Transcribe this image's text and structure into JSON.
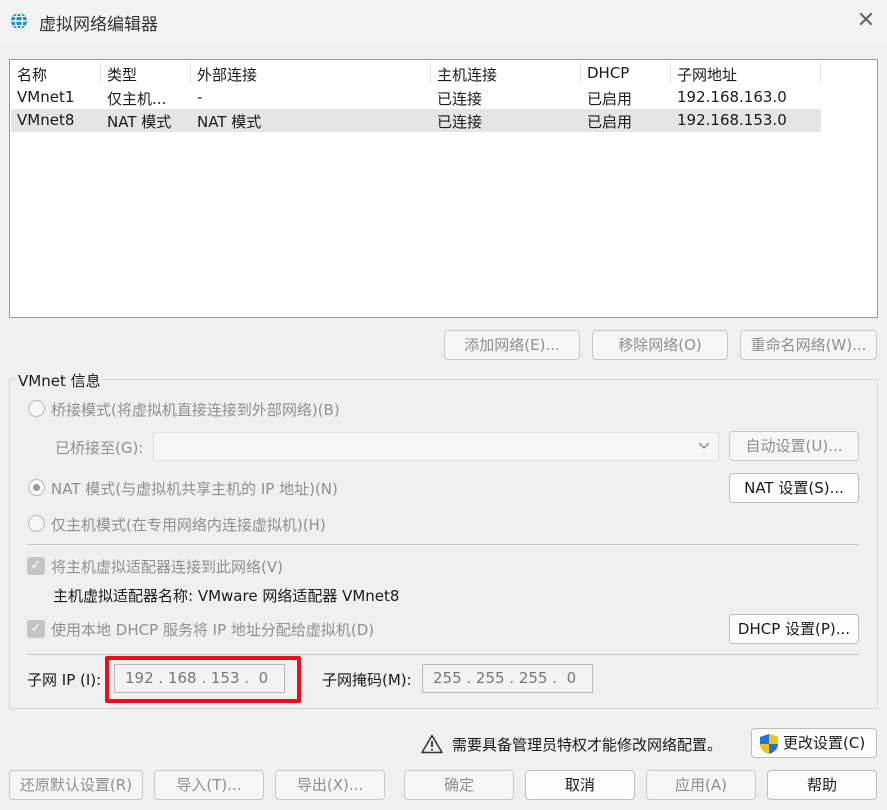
{
  "window": {
    "title": "虚拟网络编辑器",
    "icon": "globe-icon",
    "close_icon": "close-icon"
  },
  "network_table": {
    "columns": [
      "名称",
      "类型",
      "外部连接",
      "主机连接",
      "DHCP",
      "子网地址"
    ],
    "rows": [
      {
        "name": "VMnet1",
        "type": "仅主机...",
        "external": "-",
        "host": "已连接",
        "dhcp": "已启用",
        "subnet": "192.168.163.0",
        "selected": false
      },
      {
        "name": "VMnet8",
        "type": "NAT 模式",
        "external": "NAT 模式",
        "host": "已连接",
        "dhcp": "已启用",
        "subnet": "192.168.153.0",
        "selected": true
      }
    ]
  },
  "network_buttons": {
    "add": "添加网络(E)...",
    "remove": "移除网络(O)",
    "rename": "重命名网络(W)..."
  },
  "vmnet_info": {
    "group_label": "VMnet 信息",
    "bridged_label": "桥接模式(将虚拟机直接连接到外部网络)(B)",
    "bridged_to_label": "已桥接至(G):",
    "bridged_to_value": "",
    "auto_settings": "自动设置(U)...",
    "nat_label": "NAT 模式(与虚拟机共享主机的 IP 地址)(N)",
    "nat_settings": "NAT 设置(S)...",
    "hostonly_label": "仅主机模式(在专用网络内连接虚拟机)(H)",
    "selected_mode": "nat",
    "connect_adapter_label": "将主机虚拟适配器连接到此网络(V)",
    "connect_adapter_checked": true,
    "adapter_name_label": "主机虚拟适配器名称: VMware 网络适配器 VMnet8",
    "dhcp_label": "使用本地 DHCP 服务将 IP 地址分配给虚拟机(D)",
    "dhcp_checked": true,
    "dhcp_settings": "DHCP 设置(P)...",
    "subnet_ip_label": "子网 IP (I):",
    "subnet_ip_value": "192 . 168 . 153 .  0",
    "subnet_mask_label": "子网掩码(M):",
    "subnet_mask_value": "255 . 255 . 255 .  0",
    "highlight_color": "#e8101a"
  },
  "admin_notice": {
    "text": "需要具备管理员特权才能修改网络配置。",
    "warn_icon": "warning-icon",
    "change_settings": "更改设置(C)",
    "shield_icon": "uac-shield-icon"
  },
  "footer": {
    "restore": "还原默认设置(R)",
    "import": "导入(T)...",
    "export": "导出(X)...",
    "ok": "确定",
    "cancel": "取消",
    "apply": "应用(A)",
    "help": "帮助"
  }
}
